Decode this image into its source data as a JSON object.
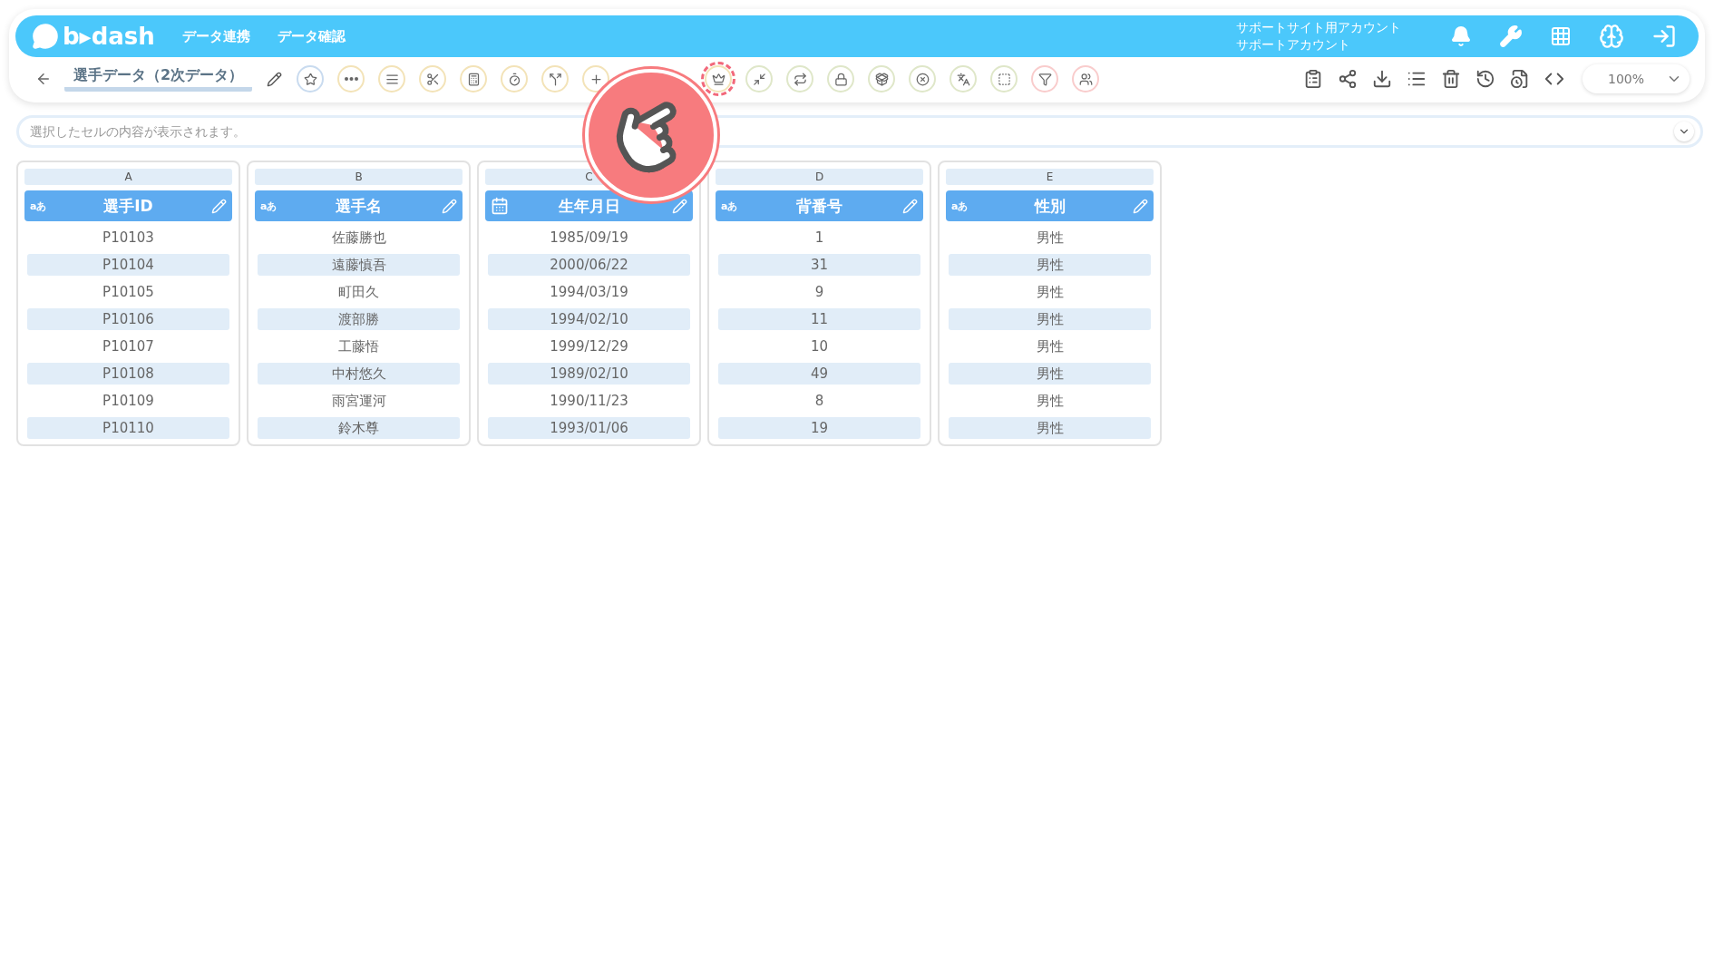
{
  "header": {
    "logo": "b▸dash",
    "nav": [
      "データ連携",
      "データ確認"
    ],
    "account": {
      "site": "サポートサイト用アカウント",
      "name": "サポートアカウント"
    }
  },
  "toolbar": {
    "title": "選手データ（2次データ）",
    "zoom": "100%"
  },
  "cell_preview": {
    "placeholder": "選択したセルの内容が表示されます。"
  },
  "columns": [
    {
      "letter": "A",
      "kind": "text",
      "type_badge": "aあ",
      "name": "選手ID",
      "cells": [
        "P10103",
        "P10104",
        "P10105",
        "P10106",
        "P10107",
        "P10108",
        "P10109",
        "P10110"
      ]
    },
    {
      "letter": "B",
      "kind": "text",
      "type_badge": "aあ",
      "name": "選手名",
      "cells": [
        "佐藤勝也",
        "遠藤慎吾",
        "町田久",
        "渡部勝",
        "工藤悟",
        "中村悠久",
        "雨宮運河",
        "鈴木尊"
      ]
    },
    {
      "letter": "C",
      "kind": "date",
      "name": "生年月日",
      "cells": [
        "1985/09/19",
        "2000/06/22",
        "1994/03/19",
        "1994/02/10",
        "1999/12/29",
        "1989/02/10",
        "1990/11/23",
        "1993/01/06"
      ]
    },
    {
      "letter": "D",
      "kind": "text",
      "type_badge": "aあ",
      "name": "背番号",
      "cells": [
        "1",
        "31",
        "9",
        "11",
        "10",
        "49",
        "8",
        "19"
      ]
    },
    {
      "letter": "E",
      "kind": "text",
      "type_badge": "aあ",
      "name": "性別",
      "cells": [
        "男性",
        "男性",
        "男性",
        "男性",
        "男性",
        "男性",
        "男性",
        "男性"
      ]
    }
  ]
}
